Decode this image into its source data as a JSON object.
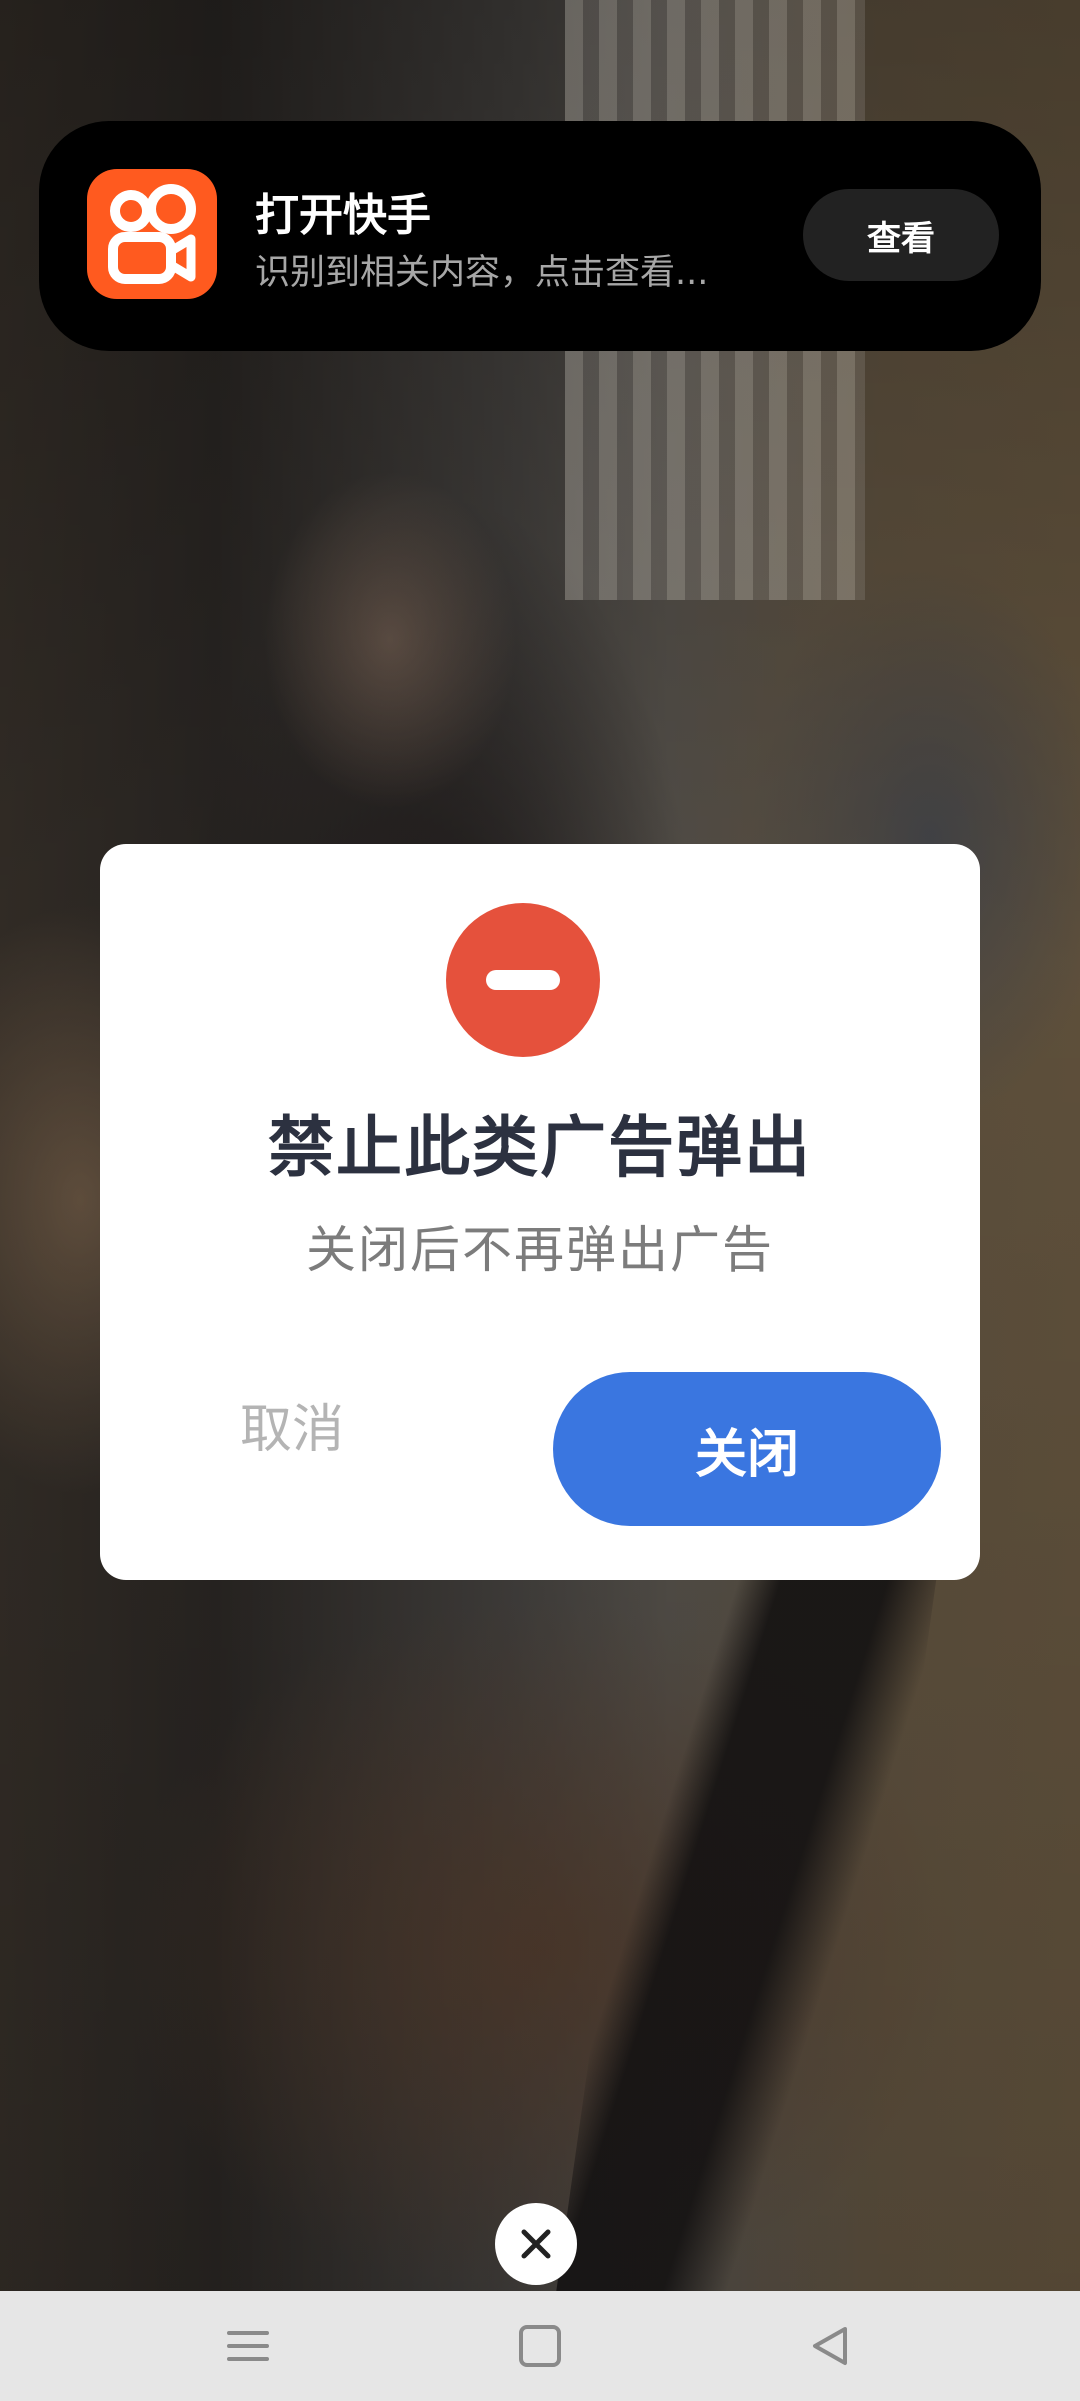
{
  "notification": {
    "app_icon": "kuaishou-app-icon",
    "title": "打开快手",
    "subtitle": "识别到相关内容，点击查看...",
    "action_label": "查看"
  },
  "dialog": {
    "icon": "stop-icon",
    "title": "禁止此类广告弹出",
    "subtitle": "关闭后不再弹出广告",
    "cancel_label": "取消",
    "close_label": "关闭"
  },
  "overlay": {
    "dismiss_icon": "close-icon"
  },
  "nav_bar": {
    "items": [
      "menu-icon",
      "home-icon",
      "back-icon"
    ]
  },
  "colors": {
    "notification_bg": "#000000",
    "app_icon_bg": "#ff5a1f",
    "stop_icon_bg": "#e5513c",
    "close_button_bg": "#3a76e0",
    "dialog_title": "#2c3140"
  }
}
